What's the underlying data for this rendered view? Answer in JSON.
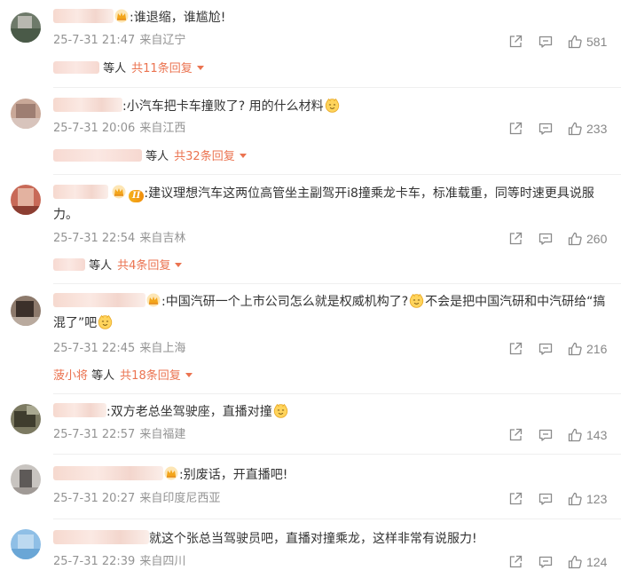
{
  "comments": [
    {
      "text": ":谁退缩，谁尴尬!",
      "time": "25-7-31 21:47",
      "source": "来自辽宁",
      "likes": "581",
      "reply_suffix": "等人",
      "reply_count": "共11条回复"
    },
    {
      "text": ":小汽车把卡车撞败了? 用的什么材料",
      "time": "25-7-31 20:06",
      "source": "来自江西",
      "likes": "233",
      "reply_suffix": "等人",
      "reply_count": "共32条回复"
    },
    {
      "badge": "II",
      "text": ":建议理想汽车这两位高管坐主副驾开i8撞乘龙卡车，标准载重，同等时速更具说服力。",
      "time": "25-7-31 22:54",
      "source": "来自吉林",
      "likes": "260",
      "reply_suffix": "等人",
      "reply_count": "共4条回复"
    },
    {
      "text_a": ":中国汽研一个上市公司怎么就是权威机构了?",
      "text_b": "不会是把中国汽研和中汽研给“搞混了”吧",
      "time": "25-7-31 22:45",
      "source": "来自上海",
      "likes": "216",
      "reply_name": "菠小将",
      "reply_suffix": "等人",
      "reply_count": "共18条回复"
    },
    {
      "text": ":双方老总坐驾驶座，直播对撞",
      "time": "25-7-31 22:57",
      "source": "来自福建",
      "likes": "143"
    },
    {
      "text": ":别废话，开直播吧!",
      "time": "25-7-31 20:27",
      "source": "来自印度尼西亚",
      "likes": "123"
    },
    {
      "text": "就这个张总当驾驶员吧，直播对撞乘龙，这样非常有说服力!",
      "time": "25-7-31 22:39",
      "source": "来自四川",
      "likes": "124"
    }
  ],
  "icons": {
    "share": "share-icon",
    "comment": "comment-icon",
    "like": "thumbs-up-icon",
    "crown": "crown-icon",
    "emoji": "doge-emoji-icon"
  },
  "colors": {
    "accent": "#eb7350",
    "meta": "#939393",
    "text": "#333333"
  }
}
